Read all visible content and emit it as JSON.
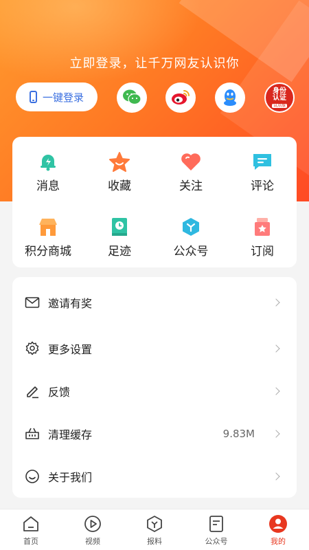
{
  "header": {
    "prompt": "立即登录，让千万网友认识你",
    "login_button": "一键登录",
    "social": [
      {
        "name": "wechat-icon",
        "color": "#3fb950"
      },
      {
        "name": "weibo-icon",
        "color": "#e6162d"
      },
      {
        "name": "qq-icon",
        "color": "#2b8dfc"
      }
    ],
    "id_badge": {
      "line1": "身份",
      "line2": "认证",
      "line3": "试点版"
    }
  },
  "grid": [
    {
      "label": "消息",
      "icon": "bell-icon",
      "color": "#2fc3a4"
    },
    {
      "label": "收藏",
      "icon": "star-icon",
      "color": "#ff7a3a"
    },
    {
      "label": "关注",
      "icon": "heart-icon",
      "color": "#ff6b5a"
    },
    {
      "label": "评论",
      "icon": "comment-icon",
      "color": "#2fc0e0"
    },
    {
      "label": "积分商城",
      "icon": "shop-icon",
      "color": "#ff9a3a"
    },
    {
      "label": "足迹",
      "icon": "clock-book-icon",
      "color": "#2fc3a4"
    },
    {
      "label": "公众号",
      "icon": "hexagon-icon",
      "color": "#2fb8e0"
    },
    {
      "label": "订阅",
      "icon": "subscribe-icon",
      "color": "#ff7b7b"
    }
  ],
  "list": [
    {
      "label": "邀请有奖",
      "icon": "mail-icon",
      "value": ""
    },
    {
      "label": "更多设置",
      "icon": "gear-icon",
      "value": ""
    },
    {
      "label": "反馈",
      "icon": "pencil-icon",
      "value": ""
    },
    {
      "label": "清理缓存",
      "icon": "basket-icon",
      "value": "9.83M"
    },
    {
      "label": "关于我们",
      "icon": "smile-icon",
      "value": ""
    }
  ],
  "tabs": [
    {
      "label": "首页",
      "icon": "home-icon",
      "active": false
    },
    {
      "label": "视频",
      "icon": "play-icon",
      "active": false
    },
    {
      "label": "报料",
      "icon": "report-icon",
      "active": false
    },
    {
      "label": "公众号",
      "icon": "article-icon",
      "active": false
    },
    {
      "label": "我的",
      "icon": "profile-icon",
      "active": true
    }
  ],
  "colors": {
    "accent": "#e8371f",
    "hero_start": "#ff9a2e",
    "hero_end": "#ff4a24"
  }
}
